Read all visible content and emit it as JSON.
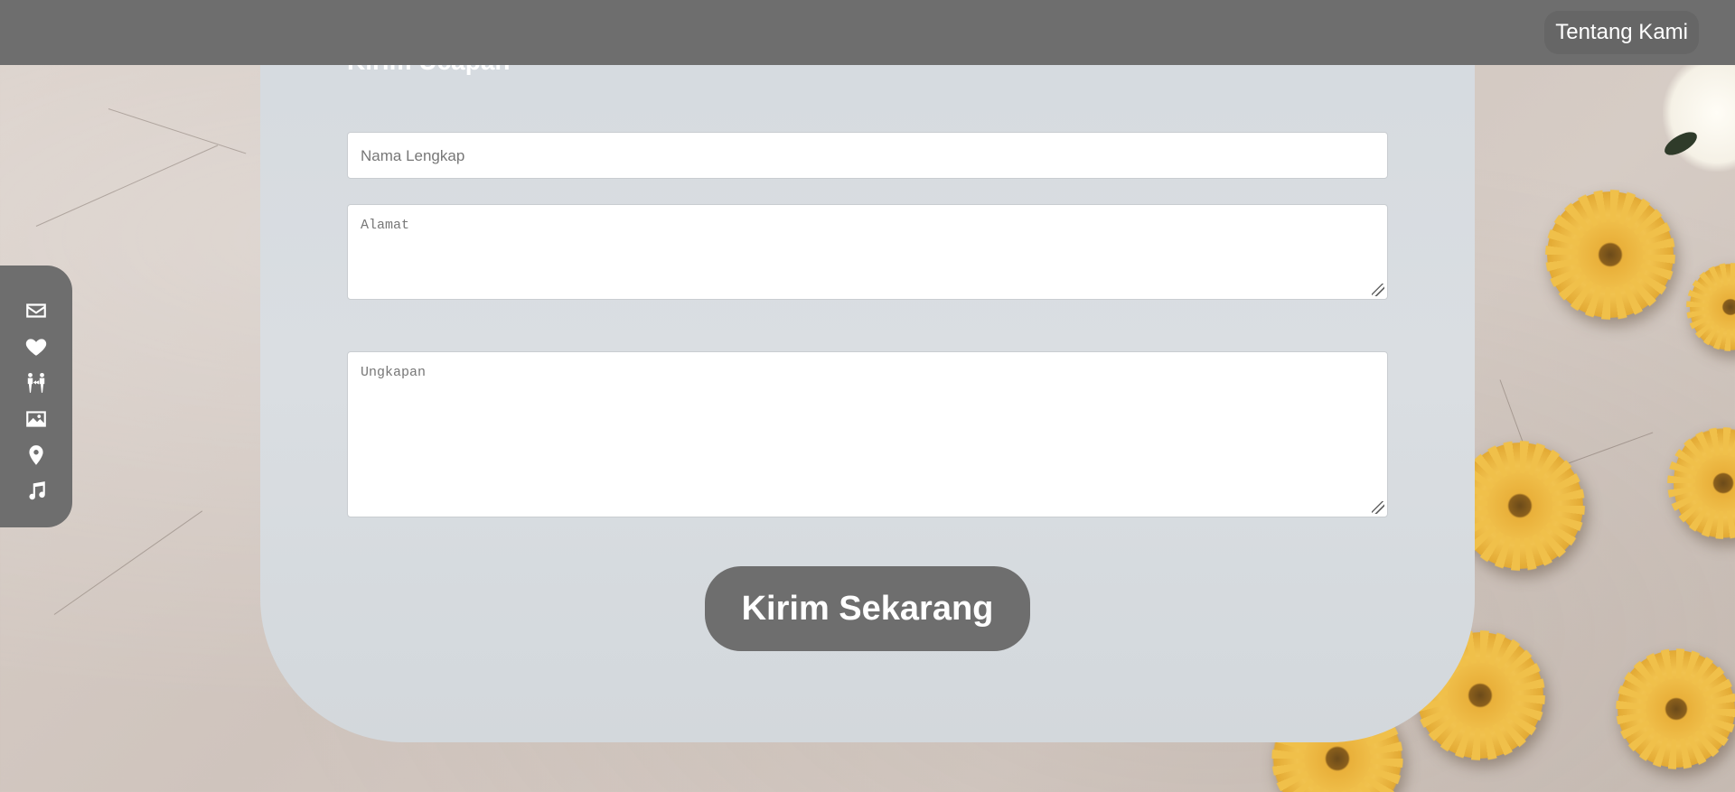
{
  "header": {
    "about_label": "Tentang Kami"
  },
  "form": {
    "title": "Kirim Ucapan",
    "name_placeholder": "Nama Lengkap",
    "address_placeholder": "Alamat",
    "message_placeholder": "Ungkapan",
    "submit_label": "Kirim Sekarang"
  },
  "sidebar": {
    "items": [
      {
        "icon": "envelope-icon"
      },
      {
        "icon": "heart-icon"
      },
      {
        "icon": "couple-icon"
      },
      {
        "icon": "image-icon"
      },
      {
        "icon": "map-pin-icon"
      },
      {
        "icon": "music-icon"
      }
    ]
  },
  "colors": {
    "bar": "#6e6e6e",
    "card": "#d7dbdf",
    "background": "#d3c9c2",
    "flower": "#f0c04a"
  }
}
